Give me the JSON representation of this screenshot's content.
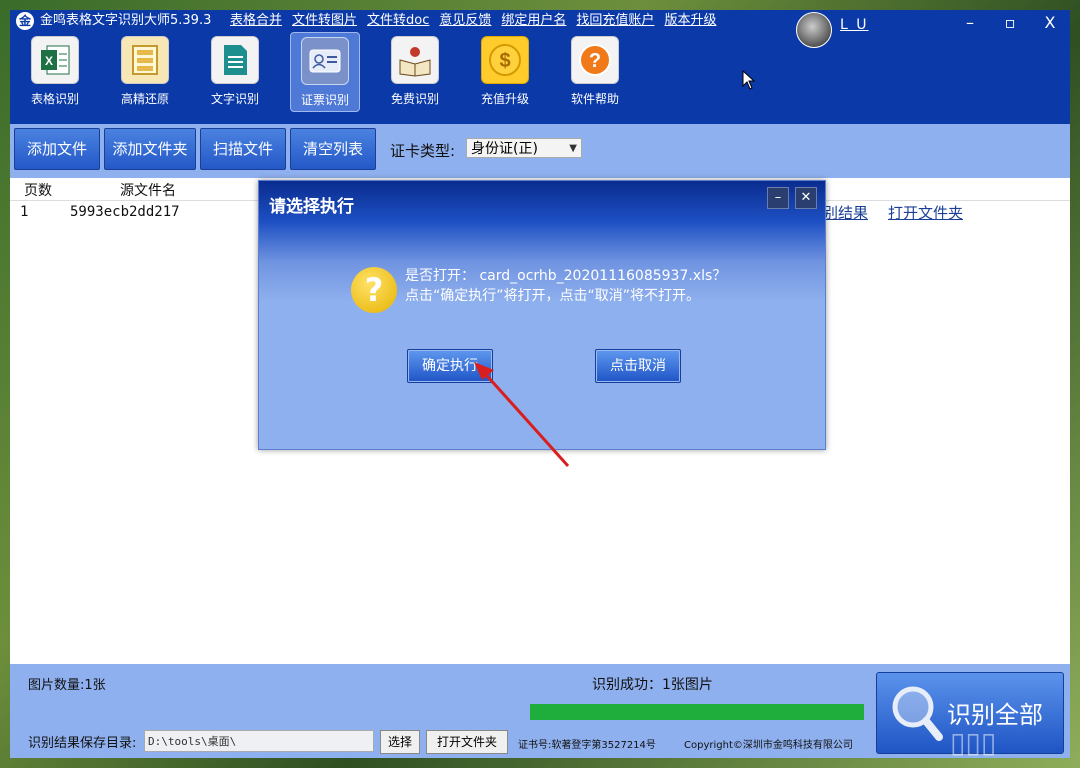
{
  "titlebar": {
    "logo": "金",
    "title": "金鸣表格文字识别大师5.39.3",
    "menu": [
      "表格合并",
      "文件转图片",
      "文件转doc",
      "意见反馈",
      "绑定用户名",
      "找回充值账户",
      "版本升级"
    ],
    "username": "L U",
    "minimize": "–",
    "maximize": "▫",
    "close": "X"
  },
  "toolbar": [
    {
      "label": "表格识别",
      "icon": "excel-icon"
    },
    {
      "label": "高精还原",
      "icon": "layout-icon"
    },
    {
      "label": "文字识别",
      "icon": "document-icon"
    },
    {
      "label": "证票识别",
      "icon": "id-card-icon"
    },
    {
      "label": "免费识别",
      "icon": "book-icon"
    },
    {
      "label": "充值升级",
      "icon": "dollar-coin-icon"
    },
    {
      "label": "软件帮助",
      "icon": "help-icon"
    }
  ],
  "actions": {
    "add_file": "添加文件",
    "add_folder": "添加文件夹",
    "scan_file": "扫描文件",
    "clear_list": "清空列表",
    "card_type_label": "证卡类型:",
    "card_type_value": "身份证(正)"
  },
  "table": {
    "headers": [
      "页数",
      "源文件名"
    ],
    "rows": [
      {
        "page": "1",
        "filename": "5993ecb2dd217",
        "result_link": "识别结果",
        "open_folder_link": "打开文件夹"
      }
    ]
  },
  "dialog": {
    "title": "请选择执行",
    "minimize": "–",
    "close": "✕",
    "question_mark": "?",
    "message_line1": "是否打开： card_ocrhb_20201116085937.xls？",
    "message_line2": "点击“确定执行”将打开，点击“取消”将不打开。",
    "confirm": "确定执行",
    "cancel": "点击取消"
  },
  "status": {
    "image_count": "图片数量:1张",
    "success": "识别成功：1张图片",
    "progress": 1.0,
    "save_dir_label": "识别结果保存目录:",
    "save_dir_value": "D:\\tools\\桌面\\",
    "choose": "选择",
    "open_folder": "打开文件夹",
    "cert": "证书号:软著登字第3527214号",
    "copyright": "Copyright©深圳市金鸣科技有限公司",
    "recognize_all": "识别全部"
  },
  "colors": {
    "title_bg": "#0b3aa8",
    "panel_bg": "#8fb0ee",
    "progress": "#1fae3c"
  }
}
